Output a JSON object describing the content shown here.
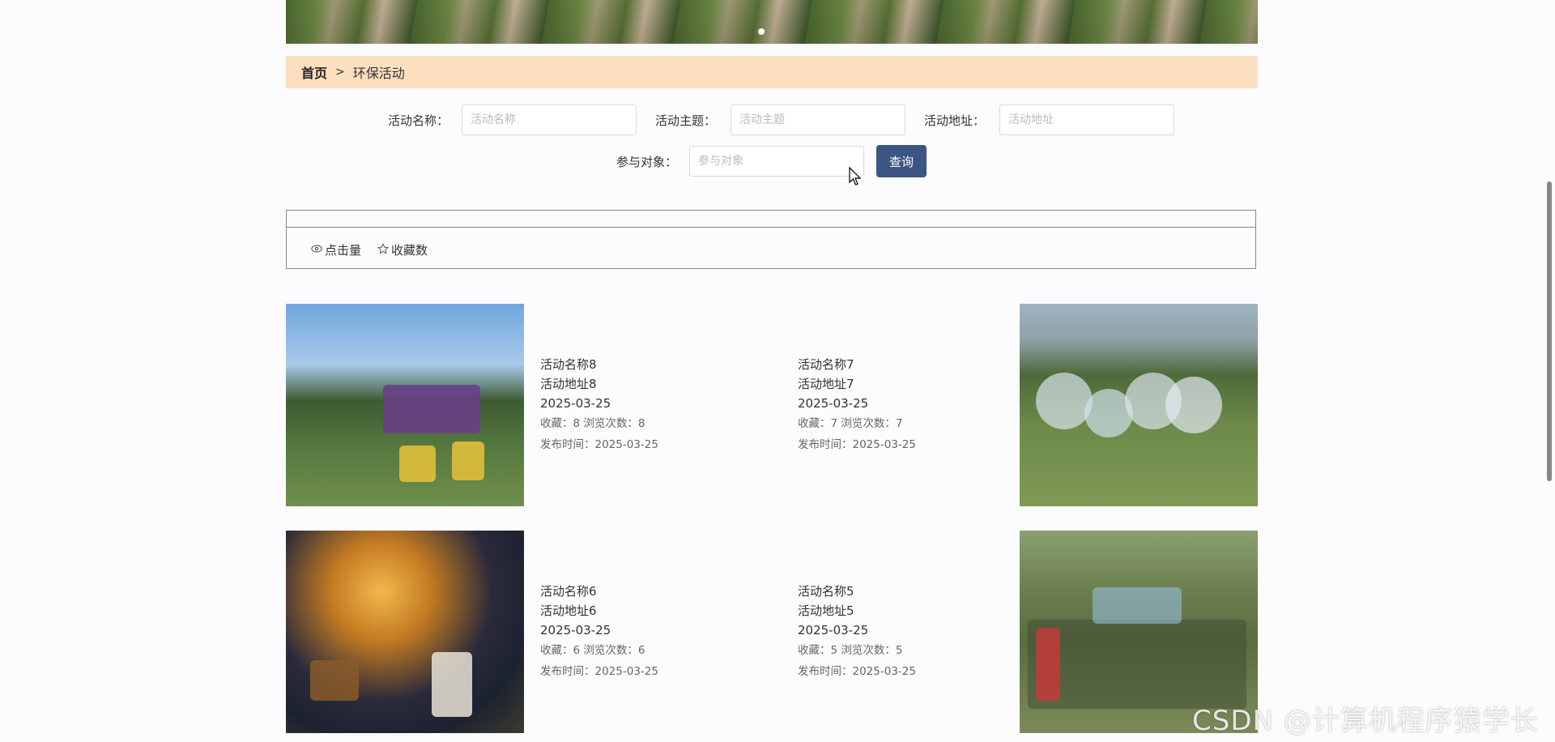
{
  "banner": {
    "active_dot": 1
  },
  "breadcrumb": {
    "home": "首页",
    "separator": ">",
    "current": "环保活动"
  },
  "search": {
    "fields": [
      {
        "label": "活动名称：",
        "placeholder": "活动名称",
        "value": ""
      },
      {
        "label": "活动主题：",
        "placeholder": "活动主题",
        "value": ""
      },
      {
        "label": "活动地址：",
        "placeholder": "活动地址",
        "value": ""
      },
      {
        "label": "参与对象：",
        "placeholder": "参与对象",
        "value": ""
      }
    ],
    "button": "查询"
  },
  "sort": {
    "clicks": "点击量",
    "favorites": "收藏数"
  },
  "activities": [
    {
      "name": "活动名称8",
      "address": "活动地址8",
      "date": "2025-03-25",
      "stats": "收藏：8  浏览次数：8",
      "published": "发布时间：2025-03-25"
    },
    {
      "name": "活动名称7",
      "address": "活动地址7",
      "date": "2025-03-25",
      "stats": "收藏：7  浏览次数：7",
      "published": "发布时间：2025-03-25"
    },
    {
      "name": "活动名称6",
      "address": "活动地址6",
      "date": "2025-03-25",
      "stats": "收藏：6  浏览次数：6",
      "published": "发布时间：2025-03-25"
    },
    {
      "name": "活动名称5",
      "address": "活动地址5",
      "date": "2025-03-25",
      "stats": "收藏：5  浏览次数：5",
      "published": "发布时间：2025-03-25"
    }
  ],
  "watermark": "CSDN @计算机程序猿学长"
}
